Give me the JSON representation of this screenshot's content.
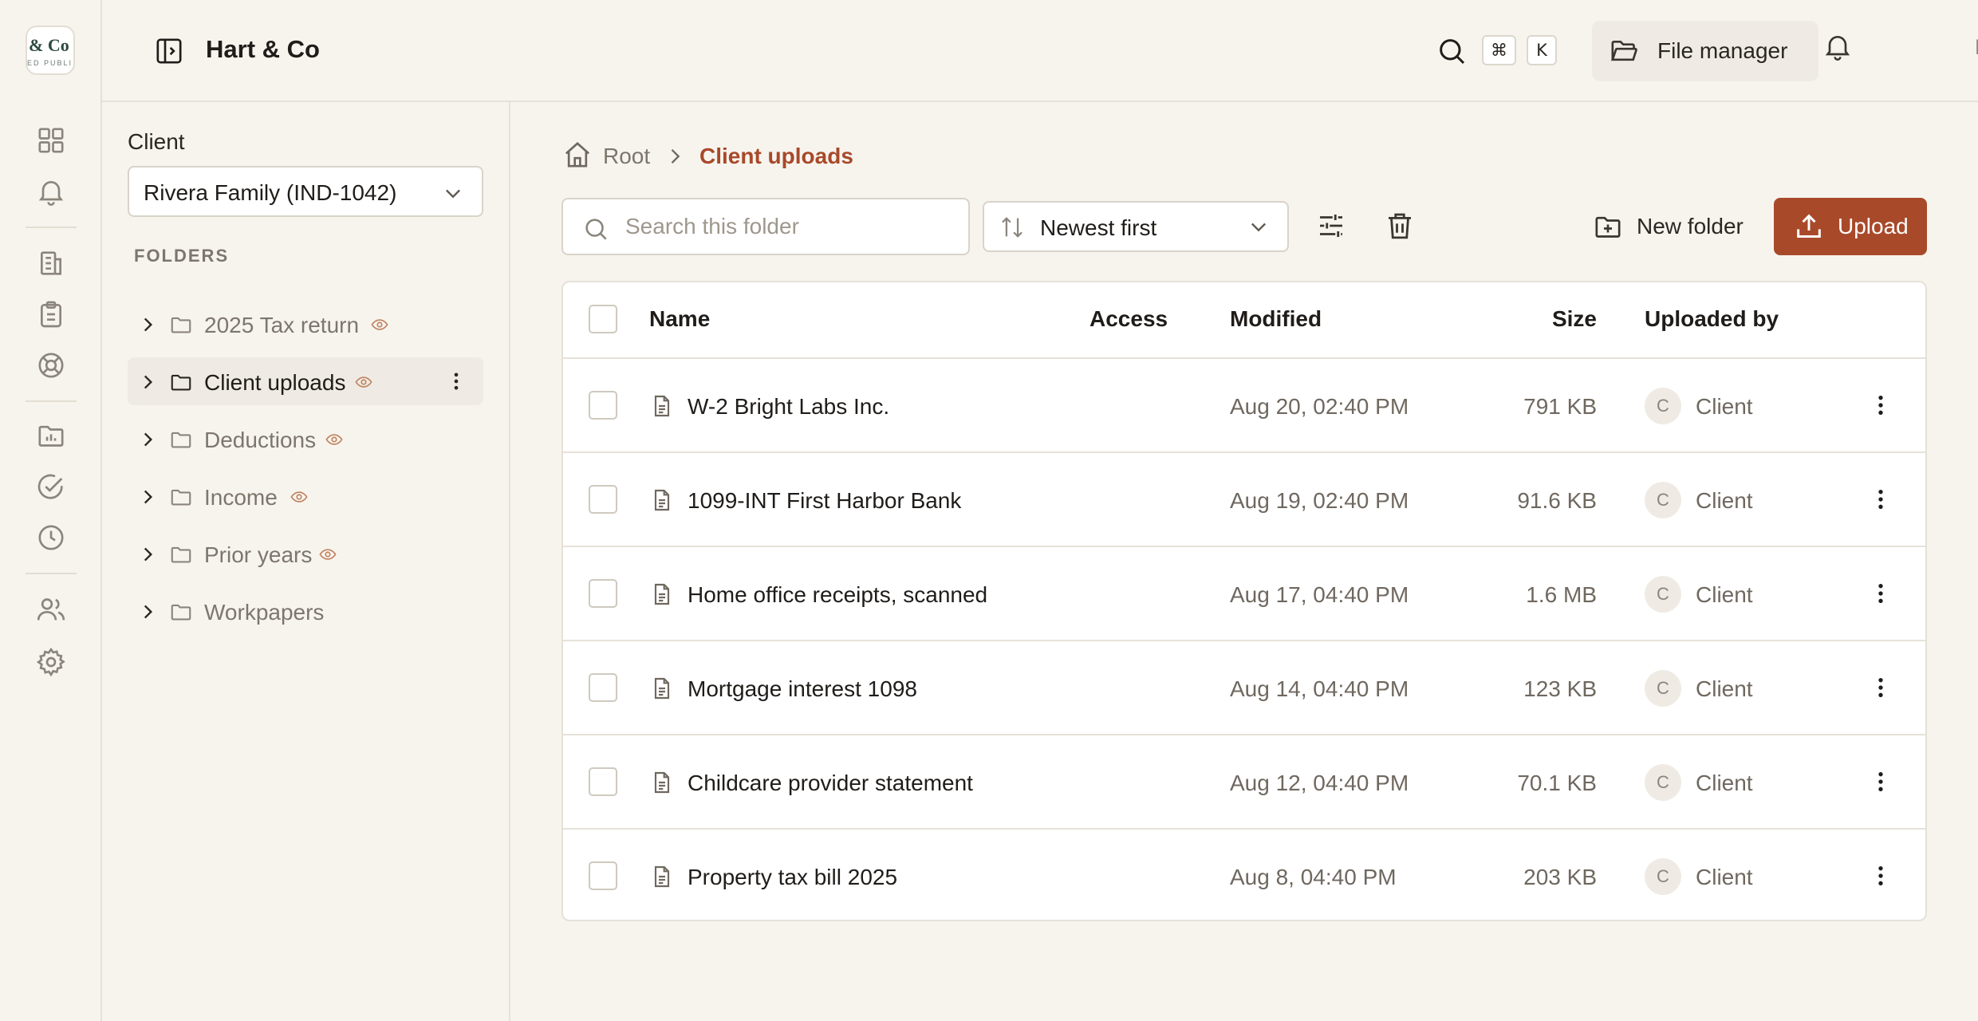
{
  "app": {
    "logo_text": "& Co",
    "logo_subtext": "ED PUBLI",
    "brand": "Hart & Co",
    "rail_icons": [
      "dashboard-icon",
      "bell-icon",
      "building-icon",
      "clipboard-icon",
      "lifebuoy-icon",
      "folder-chart-icon",
      "check-circle-icon",
      "clock-icon",
      "users-icon",
      "settings-icon"
    ]
  },
  "topbar": {
    "kbd_cmd": "⌘",
    "kbd_k": "K",
    "file_manager_label": "File manager",
    "avatar_initials": "DH"
  },
  "panel": {
    "client_label": "Client",
    "client_value": "Rivera Family (IND-1042)",
    "folders_heading": "FOLDERS",
    "folders": [
      {
        "name": "2025 Tax return",
        "shared": true,
        "active": false
      },
      {
        "name": "Client uploads",
        "shared": true,
        "active": true
      },
      {
        "name": "Deductions",
        "shared": true,
        "active": false
      },
      {
        "name": "Income",
        "shared": true,
        "active": false
      },
      {
        "name": "Prior years",
        "shared": true,
        "active": false
      },
      {
        "name": "Workpapers",
        "shared": false,
        "active": false
      }
    ]
  },
  "breadcrumb": {
    "root": "Root",
    "current": "Client uploads"
  },
  "toolbar": {
    "search_placeholder": "Search this folder",
    "sort_value": "Newest first",
    "new_folder_label": "New folder",
    "upload_label": "Upload"
  },
  "table": {
    "columns": {
      "name": "Name",
      "access": "Access",
      "modified": "Modified",
      "size": "Size",
      "uploaded_by": "Uploaded by"
    },
    "rows": [
      {
        "name": "W-2 Bright Labs Inc.",
        "modified": "Aug 20, 02:40 PM",
        "size": "791 KB",
        "avatar": "C",
        "uploaded_by": "Client"
      },
      {
        "name": "1099-INT First Harbor Bank",
        "modified": "Aug 19, 02:40 PM",
        "size": "91.6 KB",
        "avatar": "C",
        "uploaded_by": "Client"
      },
      {
        "name": "Home office receipts, scanned",
        "modified": "Aug 17, 04:40 PM",
        "size": "1.6 MB",
        "avatar": "C",
        "uploaded_by": "Client"
      },
      {
        "name": "Mortgage interest 1098",
        "modified": "Aug 14, 04:40 PM",
        "size": "123 KB",
        "avatar": "C",
        "uploaded_by": "Client"
      },
      {
        "name": "Childcare provider statement",
        "modified": "Aug 12, 04:40 PM",
        "size": "70.1 KB",
        "avatar": "C",
        "uploaded_by": "Client"
      },
      {
        "name": "Property tax bill 2025",
        "modified": "Aug 8, 04:40 PM",
        "size": "203 KB",
        "avatar": "C",
        "uploaded_by": "Client"
      }
    ]
  },
  "colors": {
    "accent": "#a8492a",
    "background": "#f7f4ee",
    "border": "#e6e1d8"
  }
}
